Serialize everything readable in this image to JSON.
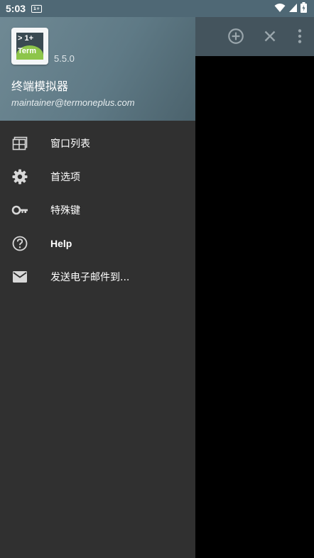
{
  "status_bar": {
    "time": "5:03",
    "notification_badge": "1+"
  },
  "drawer": {
    "header": {
      "logo_top_text": "> 1+",
      "logo_bottom_text": "Term",
      "version": "5.5.0",
      "app_name": "终端模拟器",
      "email": "maintainer@termoneplus.com"
    },
    "menu_items": [
      {
        "label": "窗口列表",
        "icon": "window-list-icon"
      },
      {
        "label": "首选项",
        "icon": "gear-icon"
      },
      {
        "label": "特殊键",
        "icon": "key-icon"
      },
      {
        "label": "Help",
        "icon": "help-icon"
      },
      {
        "label": "发送电子邮件到...",
        "icon": "email-icon"
      }
    ]
  },
  "toolbar": {
    "actions": [
      "add-window-icon",
      "close-window-icon",
      "overflow-menu-icon"
    ]
  },
  "colors": {
    "status_bar": "#4f6875",
    "toolbar": "#44545d",
    "drawer_bg": "#303030",
    "header_gradient": "#6f8994",
    "logo_green": "#8dc54a",
    "terminal_bg": "#000000"
  }
}
